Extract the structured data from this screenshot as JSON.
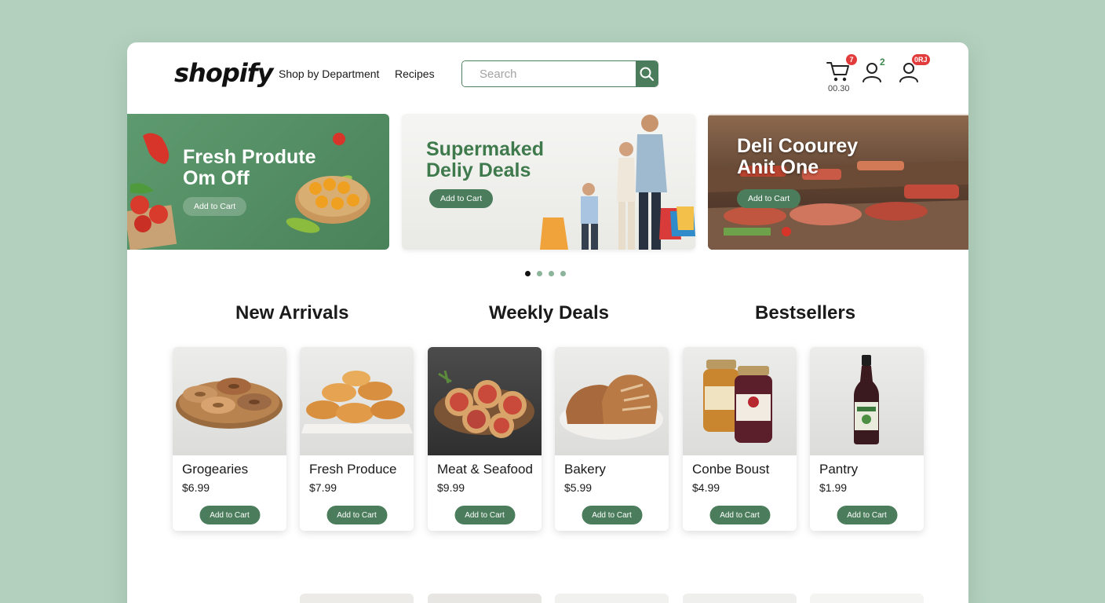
{
  "header": {
    "logo": "shopify",
    "nav": [
      "Shop by Department",
      "Recipes"
    ],
    "search_placeholder": "Search",
    "cart_badge": "7",
    "cart_total": "00.30",
    "account_badge": "2",
    "profile_badge": "0RJ"
  },
  "banners": [
    {
      "title_line1": "Fresh Produte",
      "title_line2": "Om Off",
      "button": "Add to Cart"
    },
    {
      "title_line1": "Supermaked",
      "title_line2": "Deliy Deals",
      "button": "Add to Cart"
    },
    {
      "title_line1": "Deli Coourey",
      "title_line2": "Anit One",
      "button": "Add to Cart"
    }
  ],
  "carousel": {
    "count": 4,
    "active": 0
  },
  "sections": [
    "New Arrivals",
    "Weekly Deals",
    "Bestsellers"
  ],
  "products": [
    {
      "name": "Grogearies",
      "price": "$6.99",
      "button": "Add to Cart",
      "icon": "bagels-icon"
    },
    {
      "name": "Fresh Produce",
      "price": "$7.99",
      "button": "Add to Cart",
      "icon": "pastries-icon"
    },
    {
      "name": "Meat & Seafood",
      "price": "$9.99",
      "button": "Add to Cart",
      "icon": "pizza-bites-icon"
    },
    {
      "name": "Bakery",
      "price": "$5.99",
      "button": "Add to Cart",
      "icon": "bread-icon"
    },
    {
      "name": "Conbe Boust",
      "price": "$4.99",
      "button": "Add to Cart",
      "icon": "jars-icon"
    },
    {
      "name": "Pantry",
      "price": "$1.99",
      "button": "Add to Cart",
      "icon": "bottle-icon"
    }
  ],
  "colors": {
    "accent": "#4b7d5c",
    "page_bg": "#b3d0be",
    "badge": "#e23b3b"
  }
}
